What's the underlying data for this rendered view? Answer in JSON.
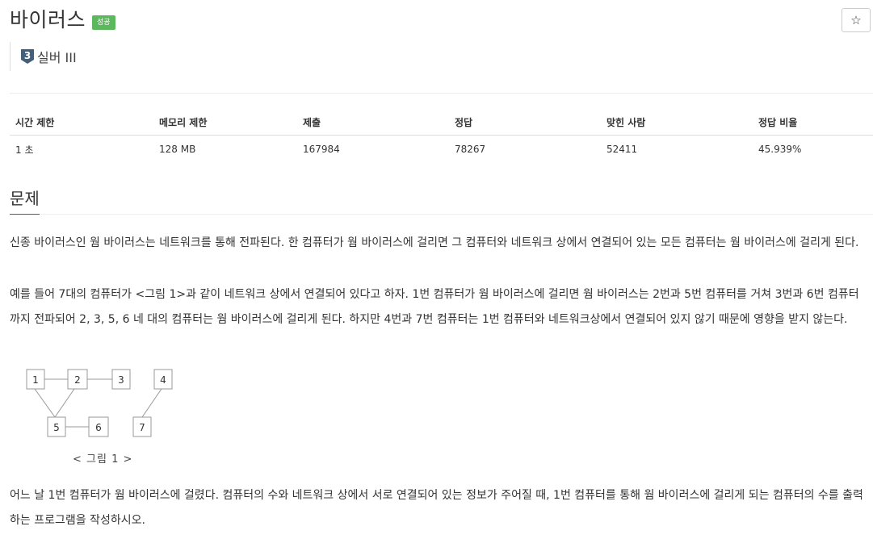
{
  "header": {
    "title": "바이러스",
    "result_badge": "성공",
    "star_icon": "☆",
    "tier_number": "3",
    "tier_label": "실버 III"
  },
  "info_table": {
    "headers": [
      "시간 제한",
      "메모리 제한",
      "제출",
      "정답",
      "맞힌 사람",
      "정답 비율"
    ],
    "values": [
      "1 초",
      "128 MB",
      "167984",
      "78267",
      "52411",
      "45.939%"
    ]
  },
  "problem": {
    "section_title": "문제",
    "paragraph1": "신종 바이러스인 웜 바이러스는 네트워크를 통해 전파된다. 한 컴퓨터가 웜 바이러스에 걸리면 그 컴퓨터와 네트워크 상에서 연결되어 있는 모든 컴퓨터는 웜 바이러스에 걸리게 된다.",
    "paragraph2": "예를 들어 7대의 컴퓨터가 <그림 1>과 같이 네트워크 상에서 연결되어 있다고 하자. 1번 컴퓨터가 웜 바이러스에 걸리면 웜 바이러스는 2번과 5번 컴퓨터를 거쳐 3번과 6번 컴퓨터까지 전파되어 2, 3, 5, 6 네 대의 컴퓨터는 웜 바이러스에 걸리게 된다. 하지만 4번과 7번 컴퓨터는 1번 컴퓨터와 네트워크상에서 연결되어 있지 않기 때문에 영향을 받지 않는다.",
    "figure": {
      "caption": "< 그림 1 >",
      "nodes": [
        "1",
        "2",
        "3",
        "4",
        "5",
        "6",
        "7"
      ]
    },
    "paragraph3": "어느 날 1번 컴퓨터가 웜 바이러스에 걸렸다. 컴퓨터의 수와 네트워크 상에서 서로 연결되어 있는 정보가 주어질 때, 1번 컴퓨터를 통해 웜 바이러스에 걸리게 되는 컴퓨터의 수를 출력하는 프로그램을 작성하시오."
  },
  "colors": {
    "success_badge": "#5cb85c",
    "tier_icon": "#435f7a",
    "section_accent": "#0076c0"
  }
}
